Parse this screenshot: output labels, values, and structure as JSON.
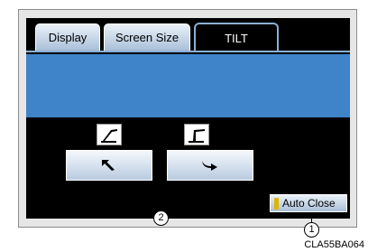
{
  "tabs": [
    {
      "label": "Display",
      "active": false
    },
    {
      "label": "Screen Size",
      "active": false
    },
    {
      "label": "TILT",
      "active": true
    }
  ],
  "buttons": {
    "tilt_forward_icon": "arrow-up-left-icon",
    "tilt_back_icon": "arrow-curve-right-icon",
    "auto_close_label": "Auto Close"
  },
  "callouts": {
    "one": "1",
    "two": "2"
  },
  "image_code": "CLA55BA064",
  "colors": {
    "screen_bg": "#000000",
    "banner": "#3f83c9",
    "tab_gradient_top": "#eaf1f9",
    "tab_gradient_bottom": "#a9bfd8",
    "indicator": "#e0b400"
  }
}
